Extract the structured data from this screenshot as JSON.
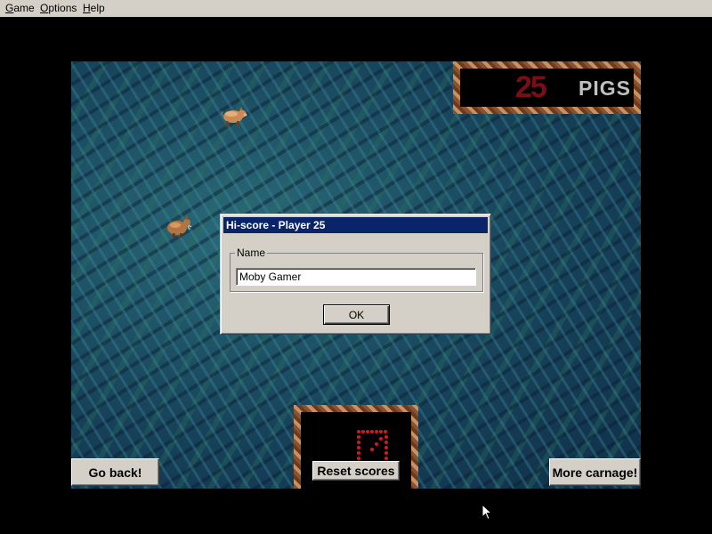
{
  "menubar": {
    "items": [
      {
        "accel": "G",
        "rest": "ame"
      },
      {
        "accel": "O",
        "rest": "ptions"
      },
      {
        "accel": "H",
        "rest": "elp"
      }
    ]
  },
  "logo": {
    "number": "25",
    "text": "PIGS"
  },
  "buttons": {
    "go_back": "Go back!",
    "reset_scores": "Reset scores",
    "more_carnage": "More carnage!"
  },
  "dialog": {
    "title": "Hi-score - Player 25",
    "group_label": "Name",
    "name_value": "Moby Gamer",
    "ok_label": "OK"
  },
  "colors": {
    "title_bar": "#0a246a",
    "logo_number": "#7a0e14",
    "counter_dots": "#d21a1a"
  }
}
